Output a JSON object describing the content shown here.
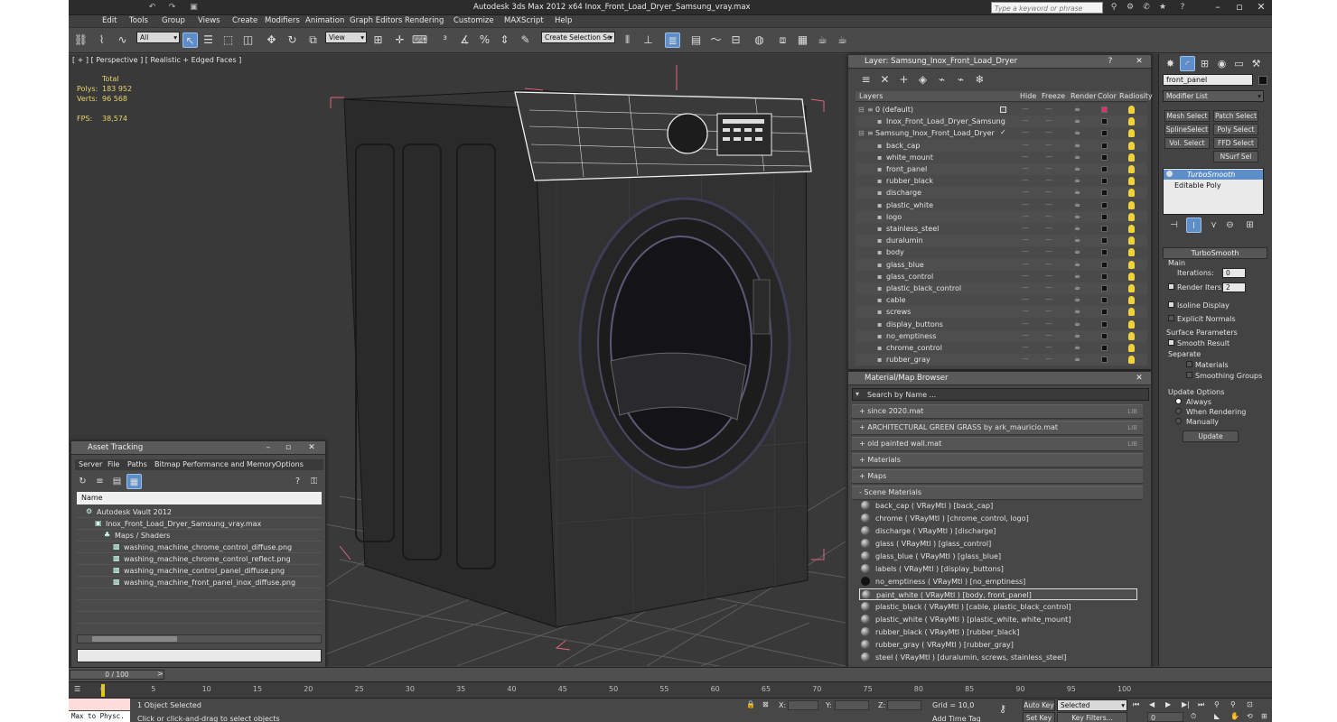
{
  "window": {
    "title": "Autodesk 3ds Max  2012 x64      Inox_Front_Load_Dryer_Samsung_vray.max",
    "search_placeholder": "Type a keyword or phrase"
  },
  "menus": [
    "Edit",
    "Tools",
    "Group",
    "Views",
    "Create",
    "Modifiers",
    "Animation",
    "Graph Editors",
    "Rendering",
    "Customize",
    "MAXScript",
    "Help"
  ],
  "toolbar": {
    "selection_filter": "All",
    "ref_coord": "View",
    "named_selection": "Create Selection Se"
  },
  "viewport": {
    "label": "[ + ] [ Perspective ] [ Realistic + Edged Faces ]",
    "stats": {
      "total_label": "Total",
      "polys_label": "Polys:",
      "polys_value": "183 952",
      "verts_label": "Verts:",
      "verts_value": "96 568",
      "fps_label": "FPS:",
      "fps_value": "38,574"
    }
  },
  "layer_manager": {
    "title": "Layer: Samsung_Inox_Front_Load_Dryer",
    "columns": [
      "Layers",
      "Hide",
      "Freeze",
      "Render",
      "Color",
      "Radiosity"
    ],
    "rows": [
      {
        "name": "0 (default)",
        "indent": 0,
        "color": "#e0306a"
      },
      {
        "name": "Inox_Front_Load_Dryer_Samsung",
        "indent": 1,
        "color": "#111111"
      },
      {
        "name": "Samsung_Inox_Front_Load_Dryer",
        "indent": 0,
        "color": "#111111"
      },
      {
        "name": "back_cap",
        "indent": 1,
        "color": "#111111"
      },
      {
        "name": "white_mount",
        "indent": 1,
        "color": "#111111"
      },
      {
        "name": "front_panel",
        "indent": 1,
        "color": "#111111"
      },
      {
        "name": "rubber_black",
        "indent": 1,
        "color": "#111111"
      },
      {
        "name": "discharge",
        "indent": 1,
        "color": "#111111"
      },
      {
        "name": "plastic_white",
        "indent": 1,
        "color": "#111111"
      },
      {
        "name": "logo",
        "indent": 1,
        "color": "#111111"
      },
      {
        "name": "stainless_steel",
        "indent": 1,
        "color": "#111111"
      },
      {
        "name": "duralumin",
        "indent": 1,
        "color": "#111111"
      },
      {
        "name": "body",
        "indent": 1,
        "color": "#111111"
      },
      {
        "name": "glass_blue",
        "indent": 1,
        "color": "#111111"
      },
      {
        "name": "glass_control",
        "indent": 1,
        "color": "#111111"
      },
      {
        "name": "plastic_black_control",
        "indent": 1,
        "color": "#111111"
      },
      {
        "name": "cable",
        "indent": 1,
        "color": "#111111"
      },
      {
        "name": "screws",
        "indent": 1,
        "color": "#111111"
      },
      {
        "name": "display_buttons",
        "indent": 1,
        "color": "#111111"
      },
      {
        "name": "no_emptiness",
        "indent": 1,
        "color": "#111111"
      },
      {
        "name": "chrome_control",
        "indent": 1,
        "color": "#111111"
      },
      {
        "name": "rubber_gray",
        "indent": 1,
        "color": "#111111"
      }
    ]
  },
  "material_browser": {
    "title": "Material/Map Browser",
    "search_placeholder": "Search by Name ...",
    "libs": [
      {
        "name": "+ since 2020.mat",
        "tag": "LIB"
      },
      {
        "name": "+ ARCHITECTURAL GREEN GRASS by ark_mauricio.mat",
        "tag": "LIB"
      },
      {
        "name": "+ old painted wall.mat",
        "tag": "LIB"
      },
      {
        "name": "+ Materials",
        "tag": ""
      },
      {
        "name": "+ Maps",
        "tag": ""
      },
      {
        "name": "- Scene Materials",
        "tag": ""
      }
    ],
    "scene_materials": [
      "back_cap  ( VRayMtl ) [back_cap]",
      "chrome  ( VRayMtl ) [chrome_control, logo]",
      "discharge  ( VRayMtl ) [discharge]",
      "glass  ( VRayMtl ) [glass_control]",
      "glass_blue  ( VRayMtl ) [glass_blue]",
      "labels  ( VRayMtl ) [display_buttons]",
      "no_emptiness  ( VRayMtl ) [no_emptiness]",
      "paint_white  ( VRayMtl ) [body, front_panel]",
      "plastic_black  ( VRayMtl ) [cable, plastic_black_control]",
      "plastic_white  ( VRayMtl ) [plastic_white, white_mount]",
      "rubber_black  ( VRayMtl ) [rubber_black]",
      "rubber_gray  ( VRayMtl ) [rubber_gray]",
      "steel  ( VRayMtl ) [duralumin, screws, stainless_steel]"
    ],
    "selected_index": 7
  },
  "asset_tracking": {
    "title": "Asset Tracking",
    "menus": [
      "Server",
      "File",
      "Paths",
      "Bitmap Performance and Memory",
      "Options"
    ],
    "column": "Name",
    "items": [
      {
        "name": "Autodesk Vault 2012",
        "indent": 1
      },
      {
        "name": "Inox_Front_Load_Dryer_Samsung_vray.max",
        "indent": 2
      },
      {
        "name": "Maps / Shaders",
        "indent": 3
      },
      {
        "name": "washing_machine_chrome_control_diffuse.png",
        "indent": 4
      },
      {
        "name": "washing_machine_chrome_control_reflect.png",
        "indent": 4
      },
      {
        "name": "washing_machine_control_panel_diffuse.png",
        "indent": 4
      },
      {
        "name": "washing_machine_front_panel_inox_diffuse.png",
        "indent": 4
      }
    ]
  },
  "command_panel": {
    "object_name": "front_panel",
    "modifier_list": "Modifier List",
    "buttons": [
      "Mesh Select",
      "Patch Select",
      "SplineSelect",
      "Poly Select",
      "Vol. Select",
      "FFD Select",
      "NSurf Sel"
    ],
    "stack": [
      "TurboSmooth",
      "Editable Poly"
    ],
    "rollout_title": "TurboSmooth",
    "main_label": "Main",
    "iterations_label": "Iterations:",
    "iterations_value": "0",
    "render_iters_label": "Render Iters:",
    "render_iters_value": "2",
    "isoline_label": "Isoline Display",
    "explicit_label": "Explicit Normals",
    "surface_label": "Surface Parameters",
    "smooth_label": "Smooth Result",
    "separate_label": "Separate",
    "materials_label": "Materials",
    "smoothing_label": "Smoothing Groups",
    "update_label": "Update Options",
    "always_label": "Always",
    "when_rendering_label": "When Rendering",
    "manually_label": "Manually",
    "update_button": "Update"
  },
  "timeline": {
    "frame_display": "0 / 100",
    "ticks": [
      "0",
      "5",
      "10",
      "15",
      "20",
      "25",
      "30",
      "35",
      "40",
      "45",
      "50",
      "55",
      "60",
      "65",
      "70",
      "75",
      "80",
      "85",
      "90",
      "95",
      "100"
    ]
  },
  "status": {
    "maxscript": "Max to Physc.",
    "selected": "1 Object Selected",
    "prompt": "Click or click-and-drag to select objects",
    "x_label": "X:",
    "y_label": "Y:",
    "z_label": "Z:",
    "grid": "Grid = 10,0",
    "auto_key": "Auto Key",
    "selected_dd": "Selected",
    "add_time_tag": "Add Time Tag",
    "set_key": "Set Key",
    "key_filters": "Key Filters...",
    "frame": "0"
  }
}
